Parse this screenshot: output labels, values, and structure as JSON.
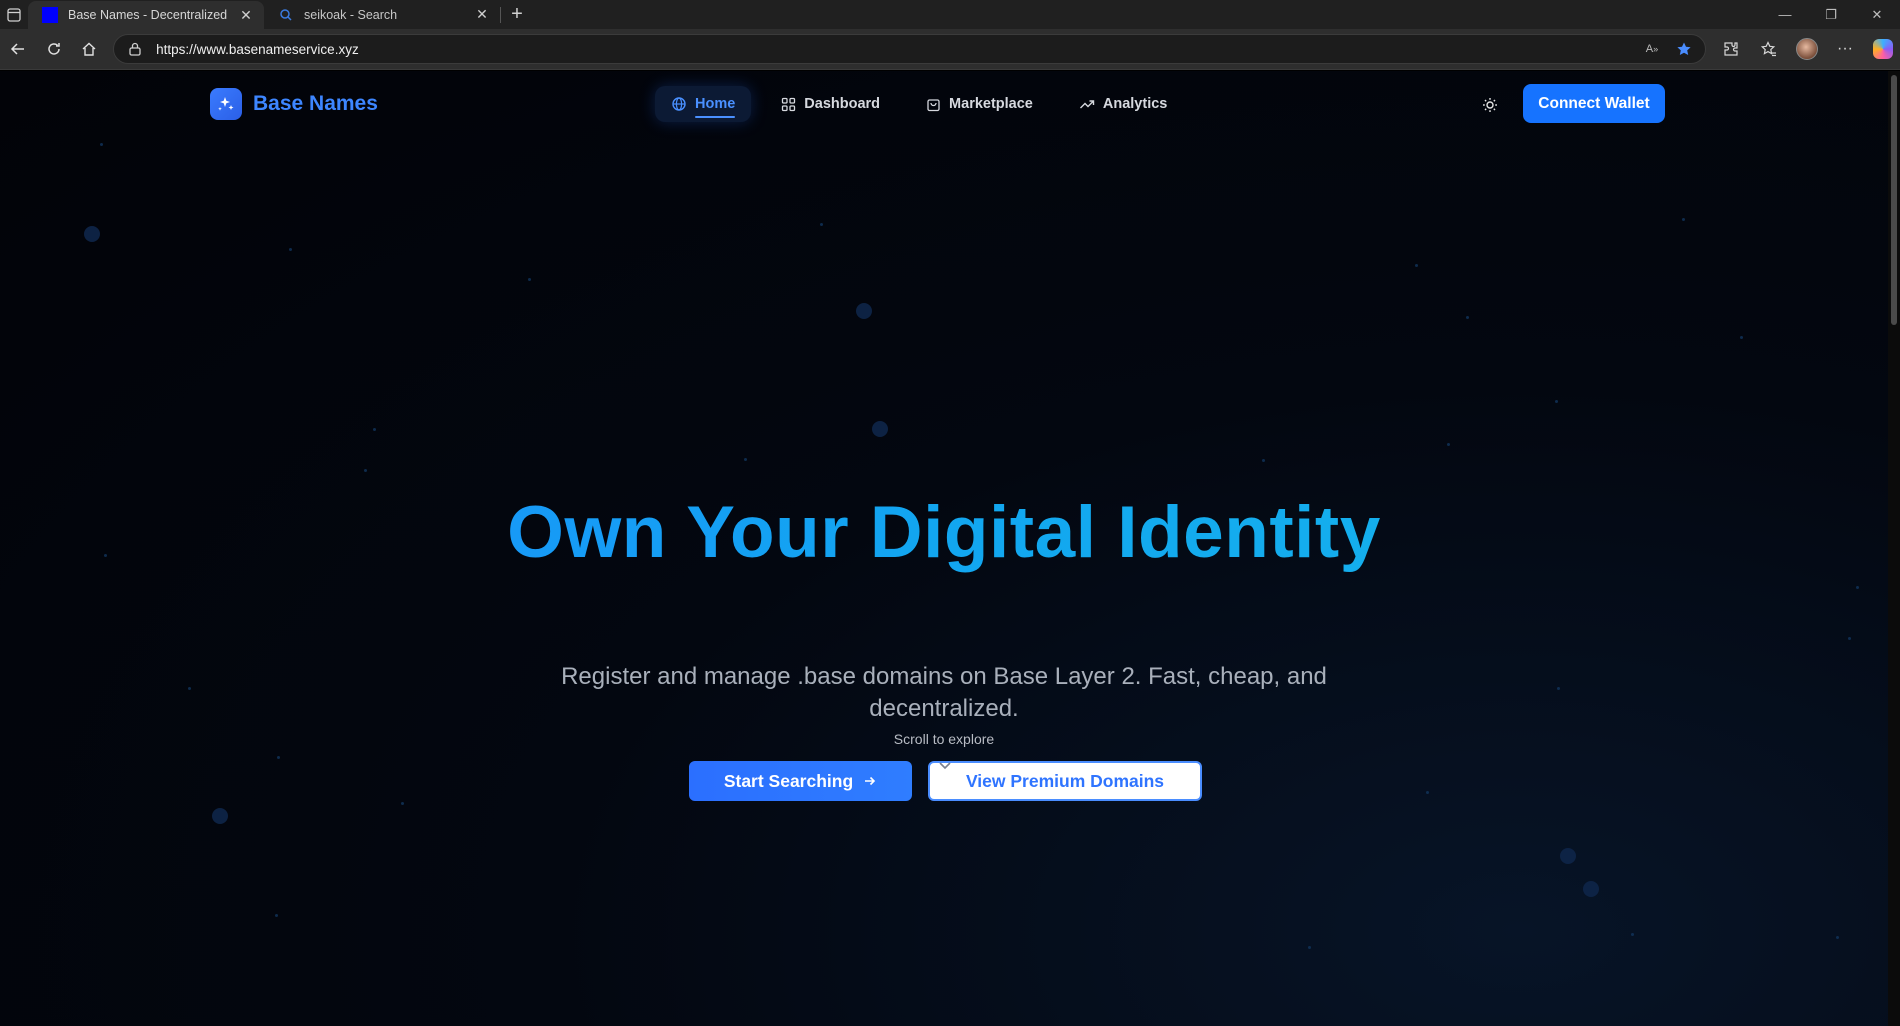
{
  "browser": {
    "tabs": [
      {
        "title": "Base Names - Decentralized Dom",
        "active": true,
        "favicon": "blue-square-icon"
      },
      {
        "title": "seikoak - Search",
        "active": false,
        "favicon": "search-icon"
      }
    ],
    "url": "https://www.basenameservice.xyz",
    "window_controls": [
      "minimize-icon",
      "restore-icon",
      "close-icon"
    ]
  },
  "site": {
    "brand": {
      "name": "Base Names",
      "logo_icon": "sparkles-icon"
    },
    "nav": [
      {
        "label": "Home",
        "icon": "globe-icon",
        "active": true
      },
      {
        "label": "Dashboard",
        "icon": "grid-icon",
        "active": false
      },
      {
        "label": "Marketplace",
        "icon": "shopping-bag-icon",
        "active": false
      },
      {
        "label": "Analytics",
        "icon": "trending-up-icon",
        "active": false
      }
    ],
    "theme_toggle_icon": "sun-icon",
    "connect_wallet_label": "Connect Wallet"
  },
  "hero": {
    "title": "Own Your Digital Identity",
    "subtitle": "Register and manage .base domains on Base Layer 2. Fast, cheap, and decentralized.",
    "scroll_hint": "Scroll to explore",
    "primary_cta": "Start Searching",
    "secondary_cta": "View Premium Domains"
  },
  "colors": {
    "accent": "#1673ff",
    "brand_text": "#3d86ff",
    "title_gradient_start": "#1d8bff",
    "title_gradient_end": "#17b8ea",
    "background": "#020308"
  }
}
